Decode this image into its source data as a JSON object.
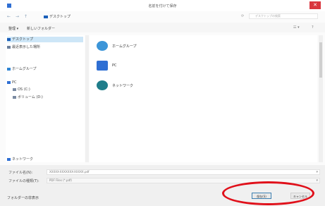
{
  "window": {
    "title": "名前を付けて保存",
    "close_glyph": "✕"
  },
  "addressbar": {
    "back_glyph": "←",
    "forward_glyph": "→",
    "up_glyph": "↑",
    "path_label": "デスクトップ",
    "refresh_glyph": "⟳",
    "search_placeholder": "デスクトップの検索"
  },
  "toolbar": {
    "organize_label": "整理 ▾",
    "new_folder_label": "新しいフォルダー",
    "view_glyph": "☷ ▾",
    "help_glyph": "?"
  },
  "navpane": {
    "items": [
      {
        "label": "デスクトップ",
        "color": "#1b5fb9"
      },
      {
        "label": "最近表示した場所",
        "color": "#6a7e9b"
      },
      {
        "label": "ホームグループ",
        "color": "#2f84d3"
      },
      {
        "label": "PC",
        "color": "#2f6fd3"
      },
      {
        "label": "OS (C:)",
        "color": "#7a8aa1"
      },
      {
        "label": "ボリューム (D:)",
        "color": "#7a8aa1"
      },
      {
        "label": "ネットワーク",
        "color": "#2f6fd3"
      }
    ]
  },
  "content": {
    "items": [
      {
        "label": "ホームグループ",
        "icon": "homegroup-icon",
        "color": "#3c95d8"
      },
      {
        "label": "PC",
        "icon": "pc-icon",
        "color": "#2f6fd3"
      },
      {
        "label": "ネットワーク",
        "icon": "network-icon",
        "color": "#1f7d8a"
      }
    ]
  },
  "footer": {
    "filename_label": "ファイル名(N):",
    "filename_value": "XXXXX-XXXXXXX-XXXXX.pdf",
    "filetype_label": "ファイルの種類(T):",
    "filetype_value": "PDF Files (*.pdf)",
    "hide_folders_label": "フォルダーの非表示",
    "save_label": "保存(S)",
    "cancel_label": "キャンセル"
  },
  "colors": {
    "accent": "#1b5fb9",
    "close": "#d9363e",
    "highlight": "#e0101a"
  }
}
